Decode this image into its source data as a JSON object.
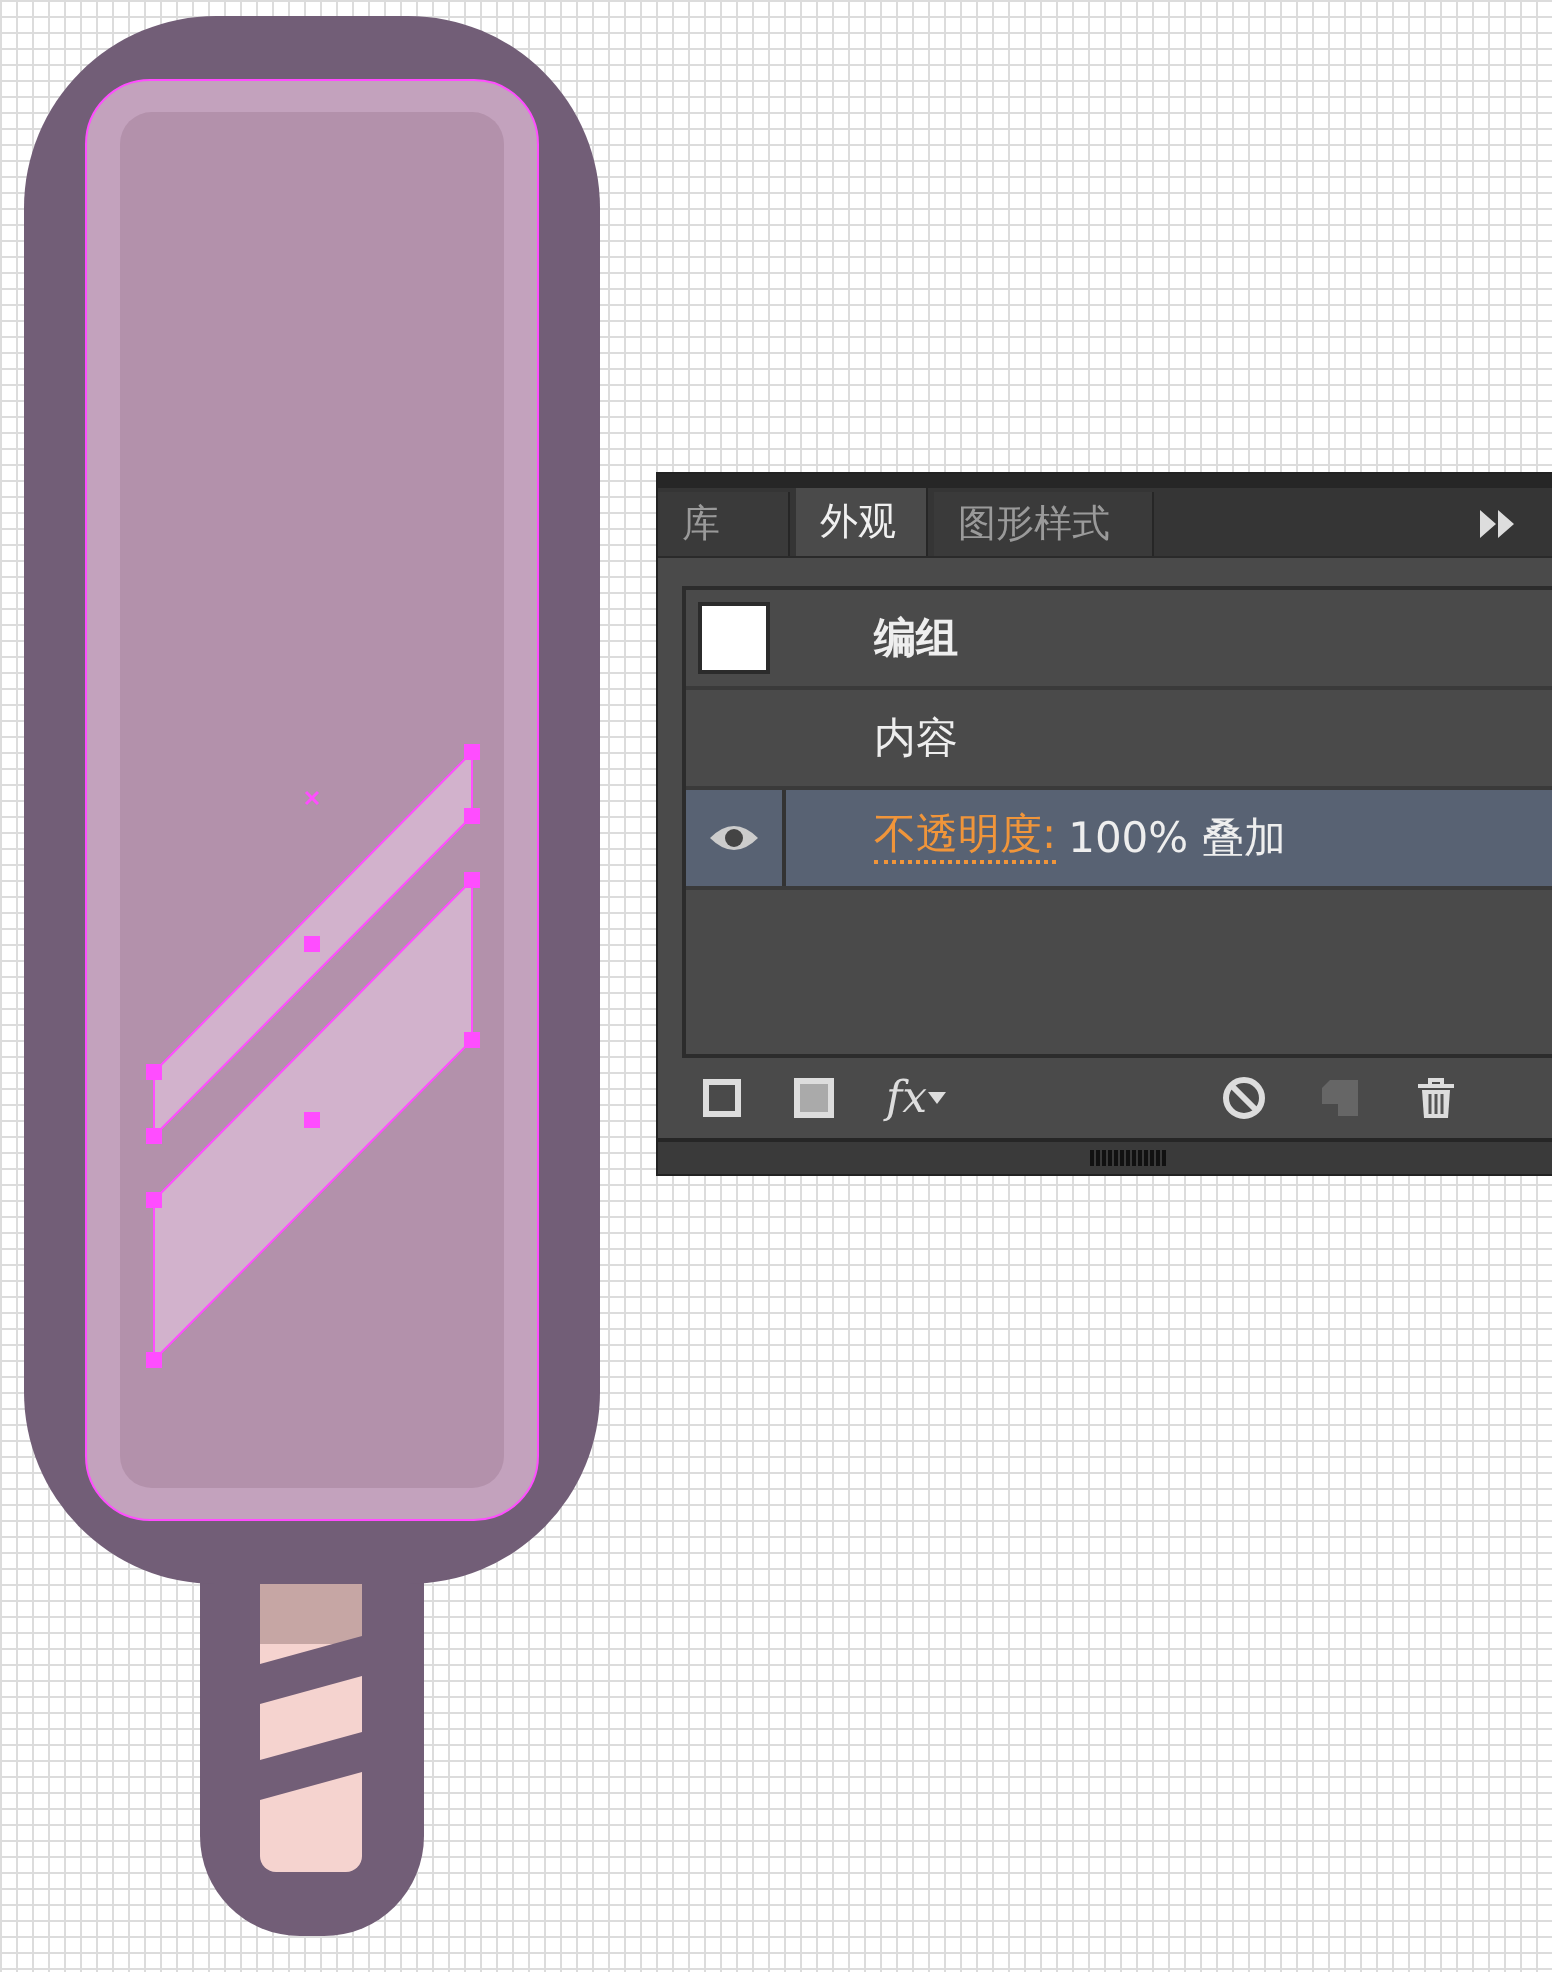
{
  "panel": {
    "tabs": [
      {
        "label": "库",
        "selected": false
      },
      {
        "label": "外观",
        "selected": true
      },
      {
        "label": "图形样式",
        "selected": false
      }
    ],
    "rows": [
      {
        "kind": "group",
        "label": "编组",
        "selected": false
      },
      {
        "kind": "content",
        "label": "内容",
        "selected": false
      },
      {
        "kind": "attribute",
        "label": "不透明度:",
        "value": "100% 叠加",
        "selected": true,
        "visible": true
      }
    ],
    "footer": {
      "fx": "fx"
    }
  }
}
